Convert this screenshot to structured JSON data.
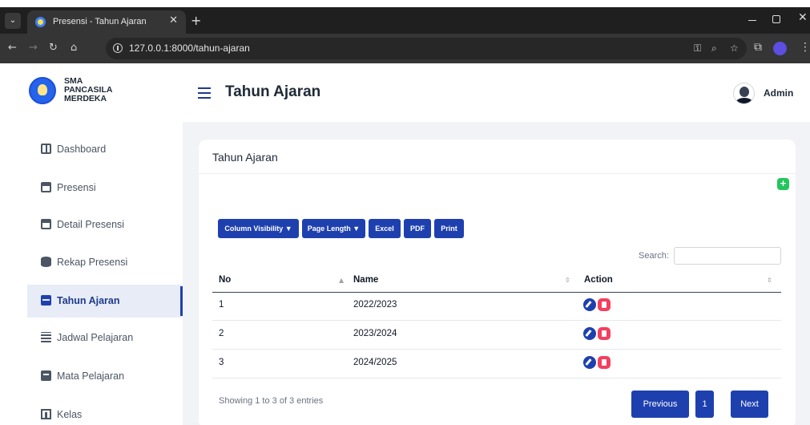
{
  "browser": {
    "tab_title": "Presensi - Tahun Ajaran",
    "url": "127.0.0.1:8000/tahun-ajaran"
  },
  "sidebar": {
    "school_name_line1": "SMA",
    "school_name_line2": "PANCASILA",
    "school_name_line3": "MERDEKA",
    "items": [
      {
        "label": "Dashboard",
        "icon": "dashboard-icon"
      },
      {
        "label": "Presensi",
        "icon": "calendar-check-icon"
      },
      {
        "label": "Detail Presensi",
        "icon": "calendar-check-icon"
      },
      {
        "label": "Rekap Presensi",
        "icon": "database-icon"
      },
      {
        "label": "Tahun Ajaran",
        "icon": "calendar-icon",
        "active": true
      },
      {
        "label": "Jadwal Pelajaran",
        "icon": "calendar-grid-icon"
      },
      {
        "label": "Mata Pelajaran",
        "icon": "book-icon"
      },
      {
        "label": "Kelas",
        "icon": "classroom-icon"
      }
    ]
  },
  "header": {
    "title": "Tahun Ajaran",
    "user_name": "Admin"
  },
  "card": {
    "title": "Tahun Ajaran",
    "buttons": [
      "Column Visibility ▼",
      "Page Length ▼",
      "Excel",
      "PDF",
      "Print"
    ],
    "search_label": "Search:",
    "search_value": "",
    "columns": [
      "No",
      "Name",
      "Action"
    ],
    "rows": [
      {
        "no": "1",
        "name": "2022/2023"
      },
      {
        "no": "2",
        "name": "2023/2024"
      },
      {
        "no": "3",
        "name": "2024/2025"
      }
    ],
    "info": "Showing 1 to 3 of 3 entries",
    "pagination": {
      "previous": "Previous",
      "page": "1",
      "next": "Next"
    }
  },
  "colors": {
    "primary": "#1e40af",
    "add": "#22c55e",
    "delete": "#f43f5e"
  }
}
